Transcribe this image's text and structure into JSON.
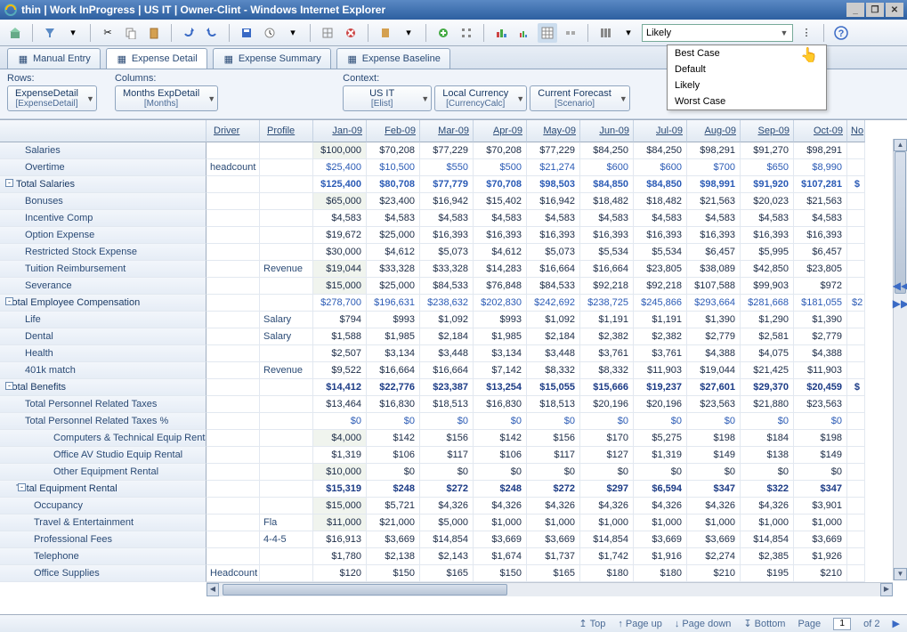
{
  "window": {
    "title": "thin | Work InProgress | US IT | Owner-Clint - Windows Internet Explorer"
  },
  "scenario": {
    "selected": "Likely",
    "options": [
      "Best Case",
      "Default",
      "Likely",
      "Worst Case"
    ]
  },
  "tabs": [
    {
      "label": "Manual Entry"
    },
    {
      "label": "Expense Detail"
    },
    {
      "label": "Expense Summary"
    },
    {
      "label": "Expense Baseline"
    }
  ],
  "dims": {
    "rows_label": "Rows:",
    "rows": {
      "top": "ExpenseDetail",
      "bot": "[ExpenseDetail]"
    },
    "cols_label": "Columns:",
    "cols": {
      "top": "Months ExpDetail",
      "bot": "[Months]"
    },
    "context_label": "Context:",
    "ctx1": {
      "top": "US IT",
      "bot": "[Elist]"
    },
    "ctx2": {
      "top": "Local Currency",
      "bot": "[CurrencyCalc]"
    },
    "ctx3": {
      "top": "Current Forecast",
      "bot": "[Scenario]"
    }
  },
  "headers": [
    "Driver",
    "Profile",
    "Jan-09",
    "Feb-09",
    "Mar-09",
    "Apr-09",
    "May-09",
    "Jun-09",
    "Jul-09",
    "Aug-09",
    "Sep-09",
    "Oct-09",
    "No"
  ],
  "rows": [
    {
      "label": "Salaries",
      "lvl": 0,
      "drv": "",
      "prf": "",
      "cells": [
        "$100,000",
        "$70,208",
        "$77,229",
        "$70,208",
        "$77,229",
        "$84,250",
        "$84,250",
        "$98,291",
        "$91,270",
        "$98,291"
      ],
      "editable": true
    },
    {
      "label": "Overtime",
      "lvl": 0,
      "drv": "headcount",
      "prf": "",
      "cells": [
        "$25,400",
        "$10,500",
        "$550",
        "$500",
        "$21,274",
        "$600",
        "$600",
        "$700",
        "$650",
        "$8,990"
      ],
      "blue": true
    },
    {
      "label": "Total Salaries",
      "lvl": 0,
      "total": true,
      "toggle": "-",
      "drv": "",
      "prf": "",
      "cells": [
        "$125,400",
        "$80,708",
        "$77,779",
        "$70,708",
        "$98,503",
        "$84,850",
        "$84,850",
        "$98,991",
        "$91,920",
        "$107,281",
        "$"
      ],
      "bold": true,
      "blue": true
    },
    {
      "label": "Bonuses",
      "lvl": 0,
      "drv": "",
      "prf": "",
      "cells": [
        "$65,000",
        "$23,400",
        "$16,942",
        "$15,402",
        "$16,942",
        "$18,482",
        "$18,482",
        "$21,563",
        "$20,023",
        "$21,563"
      ],
      "editable": true
    },
    {
      "label": "Incentive Comp",
      "lvl": 0,
      "drv": "",
      "prf": "",
      "cells": [
        "$4,583",
        "$4,583",
        "$4,583",
        "$4,583",
        "$4,583",
        "$4,583",
        "$4,583",
        "$4,583",
        "$4,583",
        "$4,583"
      ]
    },
    {
      "label": "Option Expense",
      "lvl": 0,
      "drv": "",
      "prf": "",
      "cells": [
        "$19,672",
        "$25,000",
        "$16,393",
        "$16,393",
        "$16,393",
        "$16,393",
        "$16,393",
        "$16,393",
        "$16,393",
        "$16,393"
      ]
    },
    {
      "label": "Restricted Stock Expense",
      "lvl": 0,
      "drv": "",
      "prf": "",
      "cells": [
        "$30,000",
        "$4,612",
        "$5,073",
        "$4,612",
        "$5,073",
        "$5,534",
        "$5,534",
        "$6,457",
        "$5,995",
        "$6,457"
      ]
    },
    {
      "label": "Tuition Reimbursement",
      "lvl": 0,
      "drv": "",
      "prf": "Revenue",
      "cells": [
        "$19,044",
        "$33,328",
        "$33,328",
        "$14,283",
        "$16,664",
        "$16,664",
        "$23,805",
        "$38,089",
        "$42,850",
        "$23,805"
      ],
      "editable": true
    },
    {
      "label": "Severance",
      "lvl": 0,
      "drv": "",
      "prf": "",
      "cells": [
        "$15,000",
        "$25,000",
        "$84,533",
        "$76,848",
        "$84,533",
        "$92,218",
        "$92,218",
        "$107,588",
        "$99,903",
        "$972"
      ],
      "editable": true
    },
    {
      "label": "Total Employee Compensation",
      "lvl": 0,
      "total": true,
      "total2": true,
      "toggle": "-",
      "drv": "",
      "prf": "",
      "cells": [
        "$278,700",
        "$196,631",
        "$238,632",
        "$202,830",
        "$242,692",
        "$238,725",
        "$245,866",
        "$293,664",
        "$281,668",
        "$181,055",
        "$2"
      ],
      "blue": true
    },
    {
      "label": "Life",
      "lvl": 0,
      "drv": "",
      "prf": "Salary",
      "cells": [
        "$794",
        "$993",
        "$1,092",
        "$993",
        "$1,092",
        "$1,191",
        "$1,191",
        "$1,390",
        "$1,290",
        "$1,390"
      ]
    },
    {
      "label": "Dental",
      "lvl": 0,
      "drv": "",
      "prf": "Salary",
      "cells": [
        "$1,588",
        "$1,985",
        "$2,184",
        "$1,985",
        "$2,184",
        "$2,382",
        "$2,382",
        "$2,779",
        "$2,581",
        "$2,779"
      ]
    },
    {
      "label": "Health",
      "lvl": 0,
      "drv": "",
      "prf": "",
      "cells": [
        "$2,507",
        "$3,134",
        "$3,448",
        "$3,134",
        "$3,448",
        "$3,761",
        "$3,761",
        "$4,388",
        "$4,075",
        "$4,388"
      ]
    },
    {
      "label": "401k match",
      "lvl": 0,
      "drv": "",
      "prf": "Revenue",
      "cells": [
        "$9,522",
        "$16,664",
        "$16,664",
        "$7,142",
        "$8,332",
        "$8,332",
        "$11,903",
        "$19,044",
        "$21,425",
        "$11,903"
      ]
    },
    {
      "label": "Total Benefits",
      "lvl": 0,
      "total": true,
      "total2": true,
      "toggle": "-",
      "drv": "",
      "prf": "",
      "cells": [
        "$14,412",
        "$22,776",
        "$23,387",
        "$13,254",
        "$15,055",
        "$15,666",
        "$19,237",
        "$27,601",
        "$29,370",
        "$20,459",
        "$"
      ],
      "bold": true
    },
    {
      "label": "Total Personnel Related Taxes",
      "lvl": 0,
      "drv": "",
      "prf": "",
      "cells": [
        "$13,464",
        "$16,830",
        "$18,513",
        "$16,830",
        "$18,513",
        "$20,196",
        "$20,196",
        "$23,563",
        "$21,880",
        "$23,563"
      ]
    },
    {
      "label": "Total Personnel Related Taxes %",
      "lvl": 0,
      "drv": "",
      "prf": "",
      "cells": [
        "$0",
        "$0",
        "$0",
        "$0",
        "$0",
        "$0",
        "$0",
        "$0",
        "$0",
        "$0"
      ],
      "blue": true
    },
    {
      "label": "Computers & Technical Equip Rental",
      "lvl": 2,
      "drv": "",
      "prf": "",
      "cells": [
        "$4,000",
        "$142",
        "$156",
        "$142",
        "$156",
        "$170",
        "$5,275",
        "$198",
        "$184",
        "$198"
      ],
      "editable": true
    },
    {
      "label": "Office AV Studio Equip Rental",
      "lvl": 2,
      "drv": "",
      "prf": "",
      "cells": [
        "$1,319",
        "$106",
        "$117",
        "$106",
        "$117",
        "$127",
        "$1,319",
        "$149",
        "$138",
        "$149"
      ]
    },
    {
      "label": "Other Equipment Rental",
      "lvl": 2,
      "drv": "",
      "prf": "",
      "cells": [
        "$10,000",
        "$0",
        "$0",
        "$0",
        "$0",
        "$0",
        "$0",
        "$0",
        "$0",
        "$0"
      ],
      "editable": true
    },
    {
      "label": "Total Equipment Rental",
      "lvl": 1,
      "total": true,
      "toggle": "-",
      "drv": "",
      "prf": "",
      "cells": [
        "$15,319",
        "$248",
        "$272",
        "$248",
        "$272",
        "$297",
        "$6,594",
        "$347",
        "$322",
        "$347"
      ],
      "bold": true
    },
    {
      "label": "Occupancy",
      "lvl": 1,
      "drv": "",
      "prf": "",
      "cells": [
        "$15,000",
        "$5,721",
        "$4,326",
        "$4,326",
        "$4,326",
        "$4,326",
        "$4,326",
        "$4,326",
        "$4,326",
        "$3,901"
      ],
      "editable": true
    },
    {
      "label": "Travel & Entertainment",
      "lvl": 1,
      "drv": "",
      "prf": "Fla",
      "cells": [
        "$11,000",
        "$21,000",
        "$5,000",
        "$1,000",
        "$1,000",
        "$1,000",
        "$1,000",
        "$1,000",
        "$1,000",
        "$1,000"
      ],
      "editable": true
    },
    {
      "label": "Professional Fees",
      "lvl": 1,
      "drv": "",
      "prf": "4-4-5",
      "cells": [
        "$16,913",
        "$3,669",
        "$14,854",
        "$3,669",
        "$3,669",
        "$14,854",
        "$3,669",
        "$3,669",
        "$14,854",
        "$3,669"
      ]
    },
    {
      "label": "Telephone",
      "lvl": 1,
      "drv": "",
      "prf": "",
      "cells": [
        "$1,780",
        "$2,138",
        "$2,143",
        "$1,674",
        "$1,737",
        "$1,742",
        "$1,916",
        "$2,274",
        "$2,385",
        "$1,926"
      ]
    },
    {
      "label": "Office Supplies",
      "lvl": 1,
      "drv": "Headcount",
      "prf": "",
      "cells": [
        "$120",
        "$150",
        "$165",
        "$150",
        "$165",
        "$180",
        "$180",
        "$210",
        "$195",
        "$210"
      ]
    }
  ],
  "status": {
    "top": "Top",
    "pageup": "Page up",
    "pagedown": "Page down",
    "bottom": "Bottom",
    "page_label": "Page",
    "page_current": "1",
    "page_of": "of 2"
  }
}
